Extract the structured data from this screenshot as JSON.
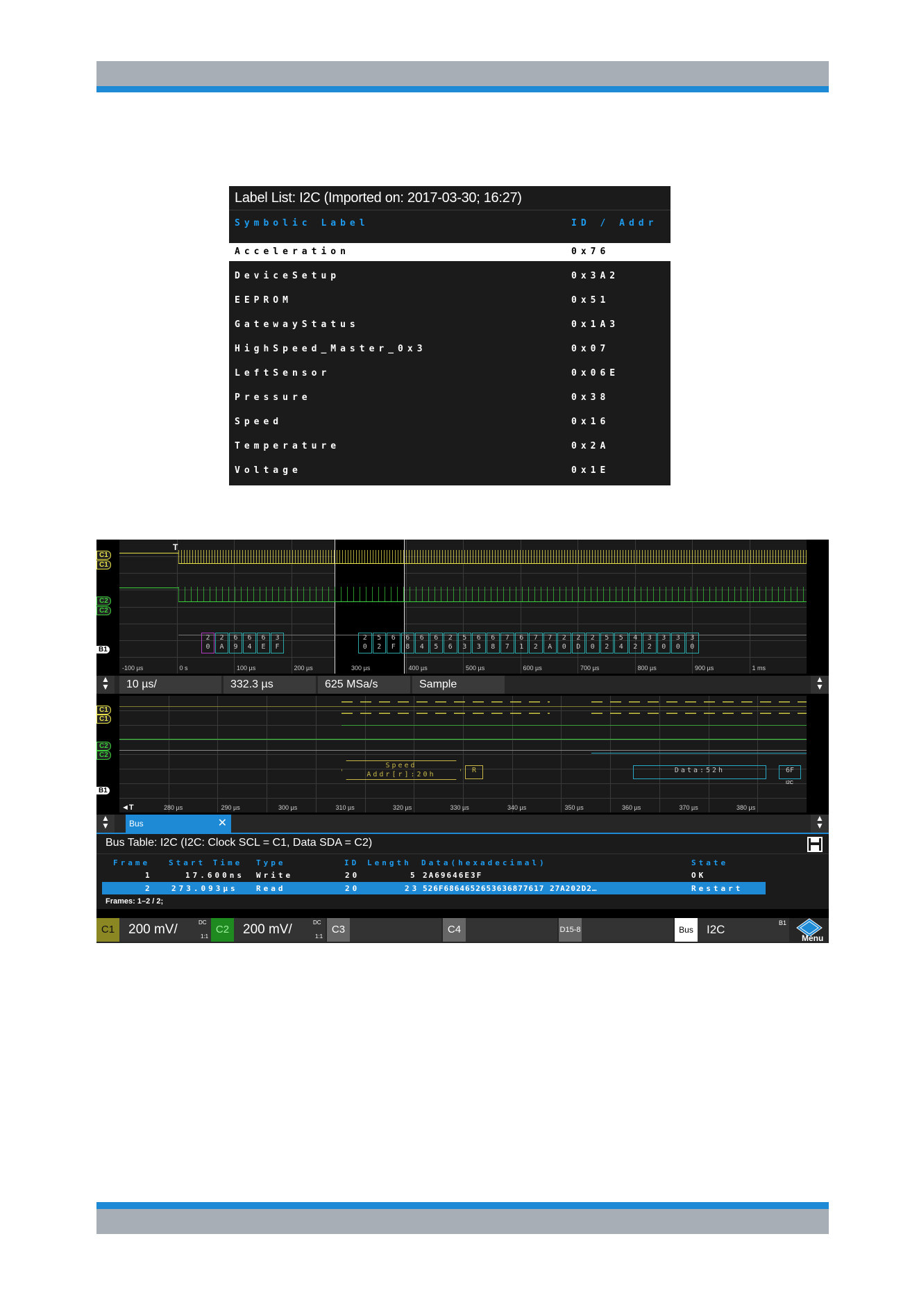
{
  "label_list": {
    "title": "Label List: I2C (Imported on: 2017-03-30; 16:27)",
    "col_symbolic": "Symbolic Label",
    "col_id": "ID / Addr",
    "rows": [
      {
        "label": "Acceleration",
        "id": "0x76"
      },
      {
        "label": "DeviceSetup",
        "id": "0x3A2"
      },
      {
        "label": "EEPROM",
        "id": "0x51"
      },
      {
        "label": "GatewayStatus",
        "id": "0x1A3"
      },
      {
        "label": "HighSpeed_Master_0x3",
        "id": "0x07"
      },
      {
        "label": "LeftSensor",
        "id": "0x06E"
      },
      {
        "label": "Pressure",
        "id": "0x38"
      },
      {
        "label": "Speed",
        "id": "0x16"
      },
      {
        "label": "Temperature",
        "id": "0x2A"
      },
      {
        "label": "Voltage",
        "id": "0x1E"
      }
    ]
  },
  "scope": {
    "channels": {
      "c1": "C1",
      "c2": "C2",
      "b1": "B1",
      "trig": "T"
    },
    "overview_ticks": [
      "-100 µs",
      "0 s",
      "100 µs",
      "200 µs",
      "300 µs",
      "400 µs",
      "500 µs",
      "600 µs",
      "700 µs",
      "800 µs",
      "900 µs",
      "1 ms"
    ],
    "overview_bytes_a": [
      [
        "2",
        "0"
      ],
      [
        "2",
        "A"
      ],
      [
        "6",
        "9"
      ],
      [
        "6",
        "4"
      ],
      [
        "6",
        "E"
      ],
      [
        "3",
        "F"
      ]
    ],
    "overview_bytes_b": [
      [
        "2",
        "0"
      ],
      [
        "5",
        "2"
      ],
      [
        "6",
        "F"
      ],
      [
        "6",
        "8"
      ],
      [
        "6",
        "4"
      ],
      [
        "6",
        "5"
      ],
      [
        "2",
        "6"
      ],
      [
        "5",
        "3"
      ],
      [
        "6",
        "3"
      ],
      [
        "6",
        "8"
      ],
      [
        "7",
        "7"
      ],
      [
        "6",
        "1"
      ],
      [
        "7",
        "2"
      ],
      [
        "7",
        "A"
      ],
      [
        "2",
        "0"
      ],
      [
        "2",
        "D"
      ],
      [
        "2",
        "0"
      ],
      [
        "5",
        "2"
      ],
      [
        "5",
        "4"
      ],
      [
        "4",
        "2"
      ],
      [
        "3",
        "2"
      ],
      [
        "3",
        "0"
      ],
      [
        "3",
        "0"
      ],
      [
        "3",
        "0"
      ]
    ],
    "timebase": "10 µs/",
    "position": "332.3 µs",
    "sample_rate": "625 MSa/s",
    "mode": "Sample",
    "zoom_ticks": [
      "280 µs",
      "290 µs",
      "300 µs",
      "310 µs",
      "320 µs",
      "330 µs",
      "340 µs",
      "350 µs",
      "360 µs",
      "370 µs",
      "380 µs"
    ],
    "decode_speed": "Speed",
    "decode_addr": "Addr[r]:20h",
    "decode_r": "R",
    "decode_data": "Data:52h",
    "decode_6f": "6F",
    "decode_i2c": "I2C",
    "bus_tab": "Bus",
    "bus_table_title": "Bus Table: I2C (I2C: Clock SCL = C1, Data SDA = C2)",
    "bus_columns": [
      "Frame",
      "Start Time",
      "Type",
      "ID",
      "Length",
      "Data(hexadecimal)",
      "State"
    ],
    "bus_rows": [
      {
        "frame": "1",
        "start": "17.600ns",
        "type": "Write",
        "id": "20",
        "length": "5",
        "data": "2A69646E3F",
        "state": "OK"
      },
      {
        "frame": "2",
        "start": "273.093µs",
        "type": "Read",
        "id": "20",
        "length": "23",
        "data": "526F6864652653636877617 27A202D2…",
        "state": "Restart"
      }
    ],
    "frames": "Frames: 1–2 / 2;",
    "c1_label": "C1",
    "c1_scale": "200 mV/",
    "c1_coupling": "DC",
    "c1_ratio": "1:1",
    "c2_label": "C2",
    "c2_scale": "200 mV/",
    "c2_coupling": "DC",
    "c2_ratio": "1:1",
    "c3_label": "C3",
    "c4_label": "C4",
    "d_label": "D15-8",
    "bus_label": "Bus",
    "bus_value": "I2C",
    "bus_b1": "B1",
    "menu_label": "Menu",
    "colors": {
      "c1": "#e9e34a",
      "c2": "#3ccf3c",
      "accent": "#1e9cf0",
      "decode": "#c8b84a"
    }
  }
}
